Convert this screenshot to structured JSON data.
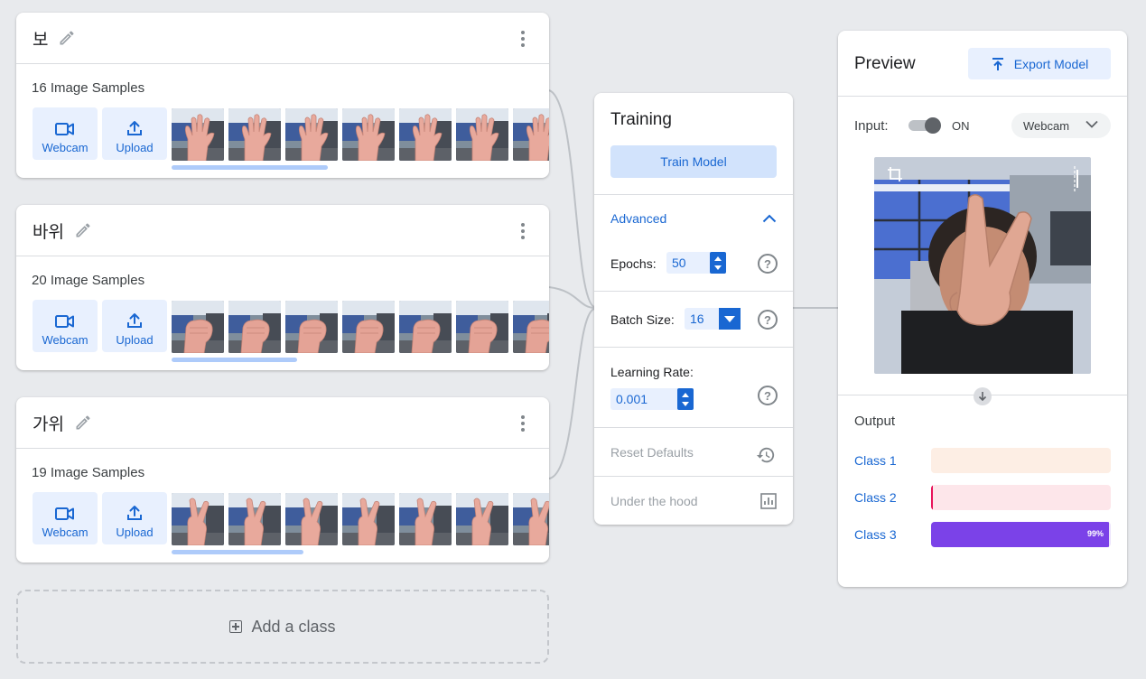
{
  "classes": [
    {
      "name": "보",
      "samples_label": "16 Image Samples",
      "webcam_label": "Webcam",
      "upload_label": "Upload"
    },
    {
      "name": "바위",
      "samples_label": "20 Image Samples",
      "webcam_label": "Webcam",
      "upload_label": "Upload"
    },
    {
      "name": "가위",
      "samples_label": "19 Image Samples",
      "webcam_label": "Webcam",
      "upload_label": "Upload"
    }
  ],
  "add_class_label": "Add a class",
  "training": {
    "title": "Training",
    "train_button": "Train Model",
    "advanced_label": "Advanced",
    "epochs_label": "Epochs:",
    "epochs_value": "50",
    "batch_size_label": "Batch Size:",
    "batch_size_value": "16",
    "learning_rate_label": "Learning Rate:",
    "learning_rate_value": "0.001",
    "help_glyph": "?",
    "reset_label": "Reset Defaults",
    "under_hood_label": "Under the hood"
  },
  "preview": {
    "title": "Preview",
    "export_button": "Export Model",
    "input_label": "Input:",
    "toggle_state": "ON",
    "source_select": "Webcam",
    "output_title": "Output",
    "outputs": [
      {
        "label": "Class 1",
        "value": 0.0,
        "pct_text": "",
        "color": "#ff9e40",
        "bg": "#fdeee4"
      },
      {
        "label": "Class 2",
        "value": 0.01,
        "pct_text": "",
        "color": "#e8135a",
        "bg": "#fde6ea"
      },
      {
        "label": "Class 3",
        "value": 0.99,
        "pct_text": "99%",
        "color": "#7b42e8",
        "bg": "#ede4fc"
      }
    ]
  },
  "colors": {
    "accent": "#1967d2",
    "light_accent": "#e8f0fe",
    "scroll": "#aecbfa"
  },
  "icons": [
    "pencil-icon",
    "more-vert-icon",
    "videocam-icon",
    "upload-icon",
    "chevron-up-icon",
    "help-icon",
    "history-icon",
    "chart-icon",
    "export-icon",
    "chevron-down-icon",
    "arrow-down-icon",
    "crop-icon",
    "add-box-icon"
  ]
}
